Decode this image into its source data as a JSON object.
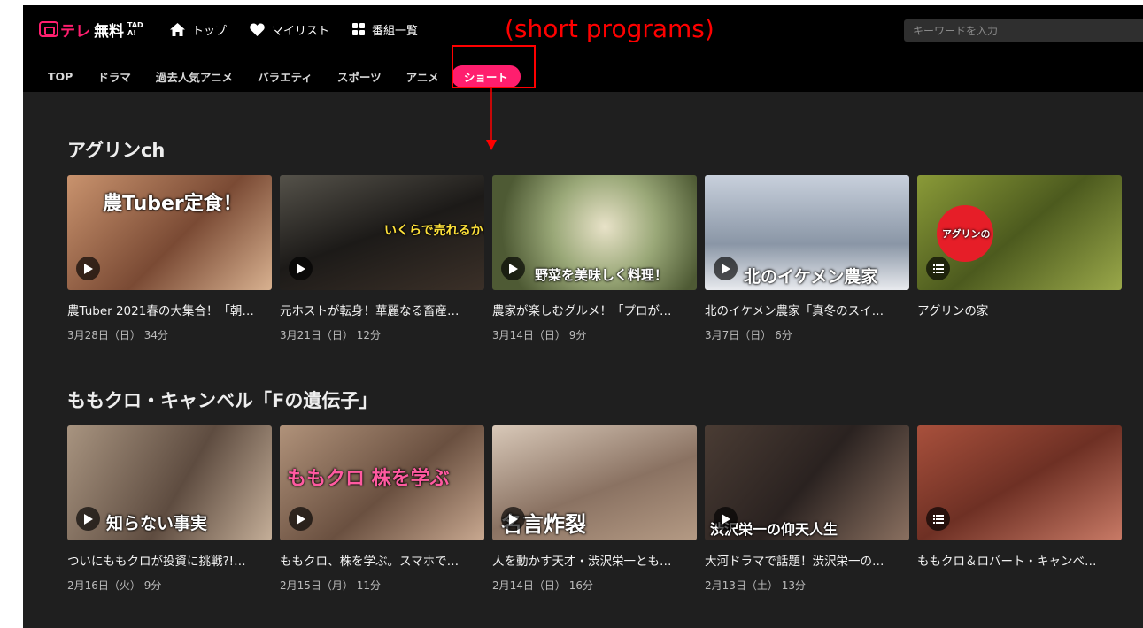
{
  "header": {
    "logo": {
      "te": "テレ",
      "jp": "無料",
      "tada": "TADA!"
    },
    "nav": [
      {
        "label": "トップ",
        "icon": "home-icon"
      },
      {
        "label": "マイリスト",
        "icon": "heart-icon"
      },
      {
        "label": "番組一覧",
        "icon": "grid-icon"
      }
    ],
    "search_placeholder": "キーワードを入力"
  },
  "categories": [
    "TOP",
    "ドラマ",
    "過去人気アニメ",
    "バラエティ",
    "スポーツ",
    "アニメ",
    "ショート"
  ],
  "active_category": "ショート",
  "annotation": "(short programs)",
  "sections": [
    {
      "title": "アグリンch",
      "cards": [
        {
          "title": "農Tuber 2021春の大集合！「朝…",
          "meta": "3月28日（日） 34分",
          "thumb_text": "農Tuber定食！",
          "color": "#b5785a"
        },
        {
          "title": "元ホストが転身！華麗なる畜産…",
          "meta": "3月21日（日） 12分",
          "thumb_text": "いくらで売れるか!?",
          "color": "#3a3a3a"
        },
        {
          "title": "農家が楽しむグルメ！「プロが…",
          "meta": "3月14日（日） 9分",
          "thumb_text": "野菜を美味しく料理！",
          "color": "#8c9a6a"
        },
        {
          "title": "北のイケメン農家「真冬のスイ…",
          "meta": "3月7日（日） 6分",
          "thumb_text": "北のイケメン農家",
          "color": "#9aa6b4"
        },
        {
          "title": "アグリンの家",
          "meta": "",
          "thumb_text": "アグリンの",
          "color": "#6e7a2e"
        }
      ]
    },
    {
      "title": "ももクロ・キャンベル「Fの遺伝子」",
      "cards": [
        {
          "title": "ついにももクロが投資に挑戦?!…",
          "meta": "2月16日（火） 9分",
          "thumb_text": "知らない事実",
          "color": "#7a6a5c"
        },
        {
          "title": "ももクロ、株を学ぶ。スマホで…",
          "meta": "2月15日（月） 11分",
          "thumb_text": "ももクロ 株を学ぶ",
          "color": "#7c6454"
        },
        {
          "title": "人を動かす天才・渋沢栄一とも…",
          "meta": "2月14日（日） 16分",
          "thumb_text": "名言炸裂",
          "color": "#8a7866"
        },
        {
          "title": "大河ドラマで話題！渋沢栄一の…",
          "meta": "2月13日（土） 13分",
          "thumb_text": "渋沢栄一の仰天人生",
          "color": "#5a4a40"
        },
        {
          "title": "ももクロ＆ロバート・キャンベ…",
          "meta": "",
          "thumb_text": "",
          "color": "#9a5040"
        }
      ]
    }
  ]
}
